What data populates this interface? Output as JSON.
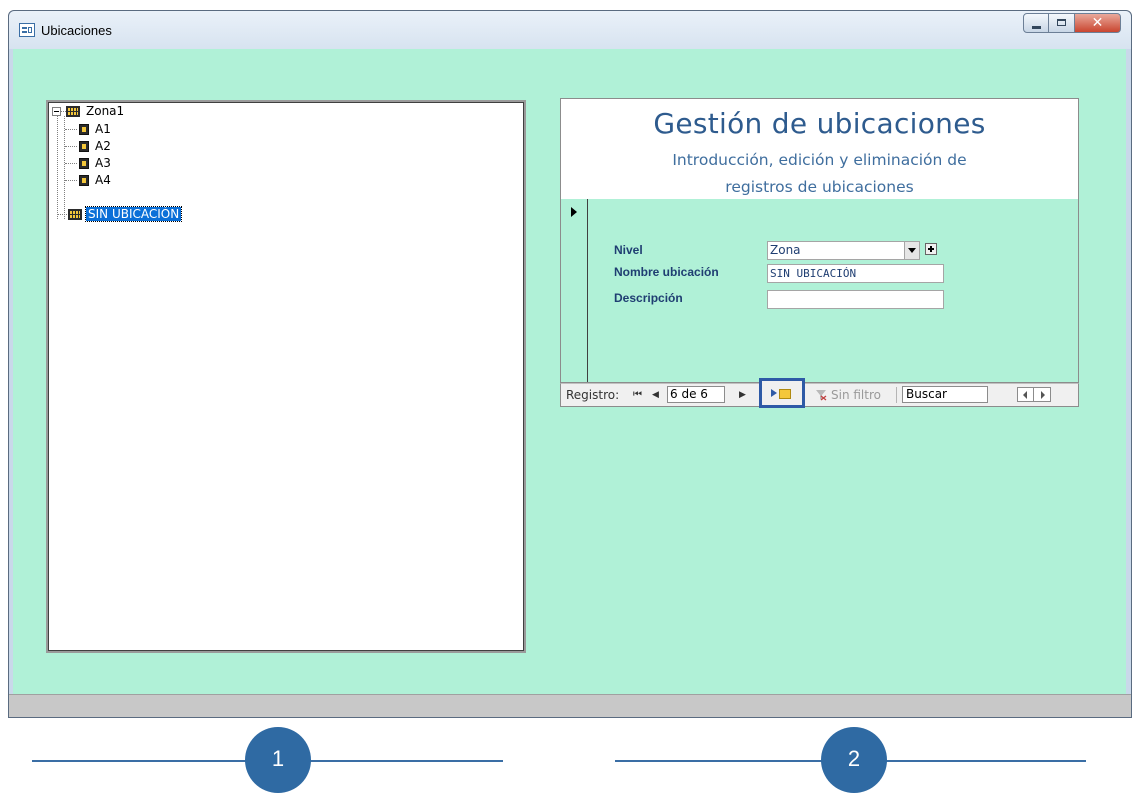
{
  "window": {
    "title": "Ubicaciones"
  },
  "tree": {
    "nodes": [
      {
        "label": "Zona1",
        "type": "zone",
        "expanded": true
      },
      {
        "label": "A1",
        "type": "location"
      },
      {
        "label": "A2",
        "type": "location"
      },
      {
        "label": "A3",
        "type": "location"
      },
      {
        "label": "A4",
        "type": "location"
      },
      {
        "label": "SIN UBICACIÓN",
        "type": "zone",
        "selected": true
      }
    ]
  },
  "form": {
    "title": "Gestión de ubicaciones",
    "subtitle_line1": "Introducción, edición y eliminación de",
    "subtitle_line2": "registros de ubicaciones",
    "fields": {
      "nivel_label": "Nivel",
      "nivel_value": "Zona",
      "nombre_label": "Nombre ubicación",
      "nombre_value": "SIN UBICACIÓN",
      "descripcion_label": "Descripción",
      "descripcion_value": ""
    }
  },
  "navbar": {
    "label": "Registro:",
    "record": "6 de 6",
    "filter": "Sin filtro",
    "search": "Buscar"
  },
  "callouts": [
    "1",
    "2"
  ],
  "colors": {
    "background": "#b0f1d7",
    "accent": "#2f6aa3",
    "title": "#2e5b8e",
    "selection": "#0a6fd8"
  }
}
